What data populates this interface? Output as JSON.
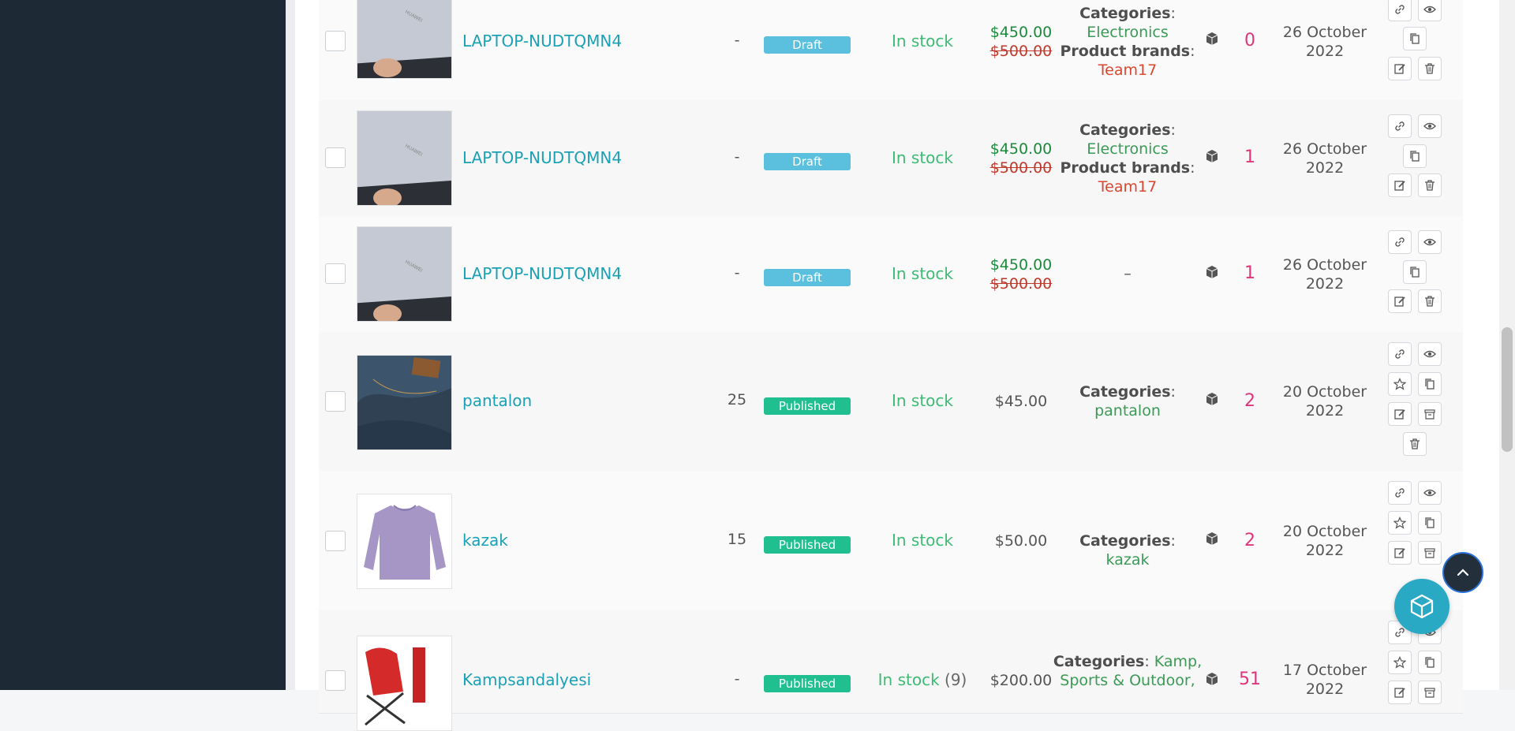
{
  "products": [
    {
      "name": "LAPTOP-NUDTQMN4",
      "qty": "-",
      "status": "Draft",
      "stock": "In stock",
      "stock_count": "",
      "sale_price": "$450.00",
      "regular_price": "$500.00",
      "categories_label": "Categories",
      "categories_value": "Electronics",
      "brands_label": "Product brands",
      "brands_value": "Team17",
      "count": "0",
      "date_line1": "26 October",
      "date_line2": "2022",
      "image": "laptop"
    },
    {
      "name": "LAPTOP-NUDTQMN4",
      "qty": "-",
      "status": "Draft",
      "stock": "In stock",
      "stock_count": "",
      "sale_price": "$450.00",
      "regular_price": "$500.00",
      "categories_label": "Categories",
      "categories_value": "Electronics",
      "brands_label": "Product brands",
      "brands_value": "Team17",
      "count": "1",
      "date_line1": "26 October",
      "date_line2": "2022",
      "image": "laptop"
    },
    {
      "name": "LAPTOP-NUDTQMN4",
      "qty": "-",
      "status": "Draft",
      "stock": "In stock",
      "stock_count": "",
      "sale_price": "$450.00",
      "regular_price": "$500.00",
      "categories_dash": "–",
      "count": "1",
      "date_line1": "26 October",
      "date_line2": "2022",
      "image": "laptop"
    },
    {
      "name": "pantalon",
      "qty": "25",
      "status": "Published",
      "stock": "In stock",
      "stock_count": "",
      "price": "$45.00",
      "categories_label": "Categories",
      "categories_value": "pantalon",
      "count": "2",
      "date_line1": "20 October",
      "date_line2": "2022",
      "image": "jeans"
    },
    {
      "name": "kazak",
      "qty": "15",
      "status": "Published",
      "stock": "In stock",
      "stock_count": "",
      "price": "$50.00",
      "categories_label": "Categories",
      "categories_value": "kazak",
      "count": "2",
      "date_line1": "20 October",
      "date_line2": "2022",
      "image": "sweater"
    },
    {
      "name": "Kampsandalyesi",
      "qty": "-",
      "status": "Published",
      "stock": "In stock",
      "stock_count": "(9)",
      "price": "$200.00",
      "categories_label": "Categories",
      "categories_value": "Kamp, Sports & Outdoor,",
      "count": "51",
      "date_line1": "17 October",
      "date_line2": "2022",
      "image": "chair"
    }
  ],
  "colors": {
    "sidebar": "#1d2935",
    "link": "#1aa1b5",
    "draft": "#5bc0de",
    "published": "#1fbf8f",
    "instock": "#3dbb74",
    "count": "#e0357a",
    "fab": "#29a9c4"
  },
  "icons": [
    "link-icon",
    "eye-icon",
    "copy-icon",
    "edit-icon",
    "trash-icon",
    "star-icon",
    "archive-icon",
    "box-icon",
    "chevron-up-icon",
    "cube-icon"
  ]
}
